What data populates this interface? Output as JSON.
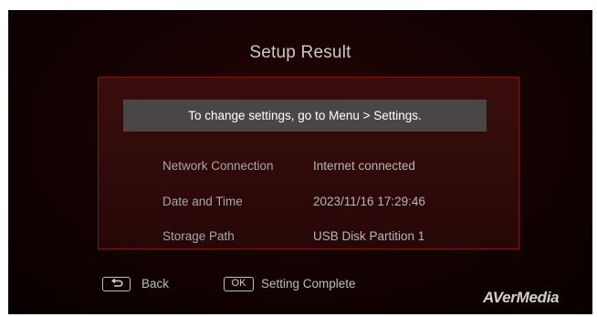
{
  "screen": {
    "title": "Setup Result",
    "notice": "To change settings, go to Menu > Settings.",
    "rows": [
      {
        "label": "Network Connection",
        "value": "Internet connected"
      },
      {
        "label": "Date and Time",
        "value": "2023/11/16 17:29:46"
      },
      {
        "label": "Storage Path",
        "value": "USB Disk Partition 1"
      }
    ]
  },
  "footer": {
    "back_label": "Back",
    "ok_key": "OK",
    "complete_label": "Setting Complete"
  },
  "brand": "AVerMedia",
  "icons": {
    "back_key": "return-arrow-icon",
    "ok_key": "ok-key-icon"
  },
  "colors": {
    "background": "#120202",
    "panel_border": "#7a1616",
    "panel_fill": "#330b0b",
    "notice_fill": "#4b4646",
    "text": "#bdbdbd"
  }
}
